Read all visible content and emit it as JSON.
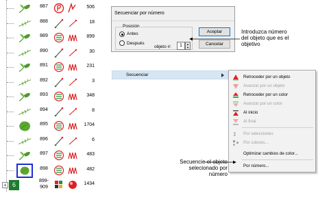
{
  "objects": [
    {
      "num": "887",
      "stitches": "506",
      "icon": "seal-icon",
      "thumb": "leaf-sprig"
    },
    {
      "num": "888",
      "stitches": "18",
      "icon": "needle-icon",
      "thumb": "fern"
    },
    {
      "num": "889",
      "stitches": "899",
      "icon": "satin-fill-icon",
      "thumb": "leaf-sprig"
    },
    {
      "num": "890",
      "stitches": "30",
      "icon": "needle-icon",
      "thumb": "fern"
    },
    {
      "num": "891",
      "stitches": "231",
      "icon": "satin-fill-icon",
      "thumb": "leaf-sprig"
    },
    {
      "num": "892",
      "stitches": "3",
      "icon": "needle-icon",
      "thumb": "fern"
    },
    {
      "num": "893",
      "stitches": "348",
      "icon": "satin-fill-icon",
      "thumb": "leaf-sprig"
    },
    {
      "num": "894",
      "stitches": "8",
      "icon": "needle-icon",
      "thumb": "fern"
    },
    {
      "num": "895",
      "stitches": "1704",
      "icon": "satin-fill-icon",
      "thumb": "leaf-big"
    },
    {
      "num": "896",
      "stitches": "6",
      "icon": "needle-icon",
      "thumb": "fern"
    },
    {
      "num": "897",
      "stitches": "483",
      "icon": "satin-fill-icon",
      "thumb": "leaf-sprig"
    },
    {
      "num": "898",
      "stitches": "482",
      "icon": "satin-fill-icon",
      "thumb": "leaf-big",
      "selected": true
    },
    {
      "num": "899-909",
      "stitches": "1434",
      "icon": "group-icon",
      "thumb": "group",
      "group_badge": "6"
    }
  ],
  "dialog": {
    "title": "Secuenciar por número",
    "group_label": "Posición",
    "radio_before": "Antes",
    "radio_after": "Después",
    "field_label": "objeto #:",
    "field_value": "1",
    "ok_label": "Aceptar",
    "cancel_label": "Cancelar"
  },
  "menu": {
    "parent_label": "Secuenciar",
    "items": [
      {
        "label": "Retroceder por un objeto",
        "enabled": true,
        "icon": "triangle-up-red-icon"
      },
      {
        "label": "Avanzar por un objeto",
        "enabled": false,
        "icon": "triangle-down-icon"
      },
      {
        "label": "Retroceder por un color",
        "enabled": true,
        "icon": "color-up-icon"
      },
      {
        "label": "Avanzar por un color",
        "enabled": false,
        "icon": "color-down-icon"
      },
      {
        "label": "Al inicio",
        "enabled": true,
        "icon": "to-start-icon"
      },
      {
        "label": "Al final",
        "enabled": false,
        "icon": "to-end-icon"
      },
      {
        "label": "Por selecciones",
        "enabled": false,
        "icon": "by-selection-icon"
      },
      {
        "label": "Por colores...",
        "enabled": false,
        "icon": "by-colors-icon"
      },
      {
        "label": "Optimizar cambios de color...",
        "enabled": true,
        "icon": ""
      },
      {
        "label": "Por número...",
        "enabled": true,
        "icon": ""
      }
    ]
  },
  "callouts": {
    "dialog_note_1": "Introduzca número",
    "dialog_note_2": "del objeto que es el",
    "dialog_note_3": "objetivo",
    "menu_note_1": "Secuencie el objeto",
    "menu_note_2": "selecionado por",
    "menu_note_3": "número"
  },
  "colors": {
    "selection_border": "#1c2bd6",
    "menu_highlight": "#d7e6f3",
    "accent_red": "#e02020",
    "leaf_green": "#4f9a2c",
    "group_badge": "#1e7d2d"
  }
}
